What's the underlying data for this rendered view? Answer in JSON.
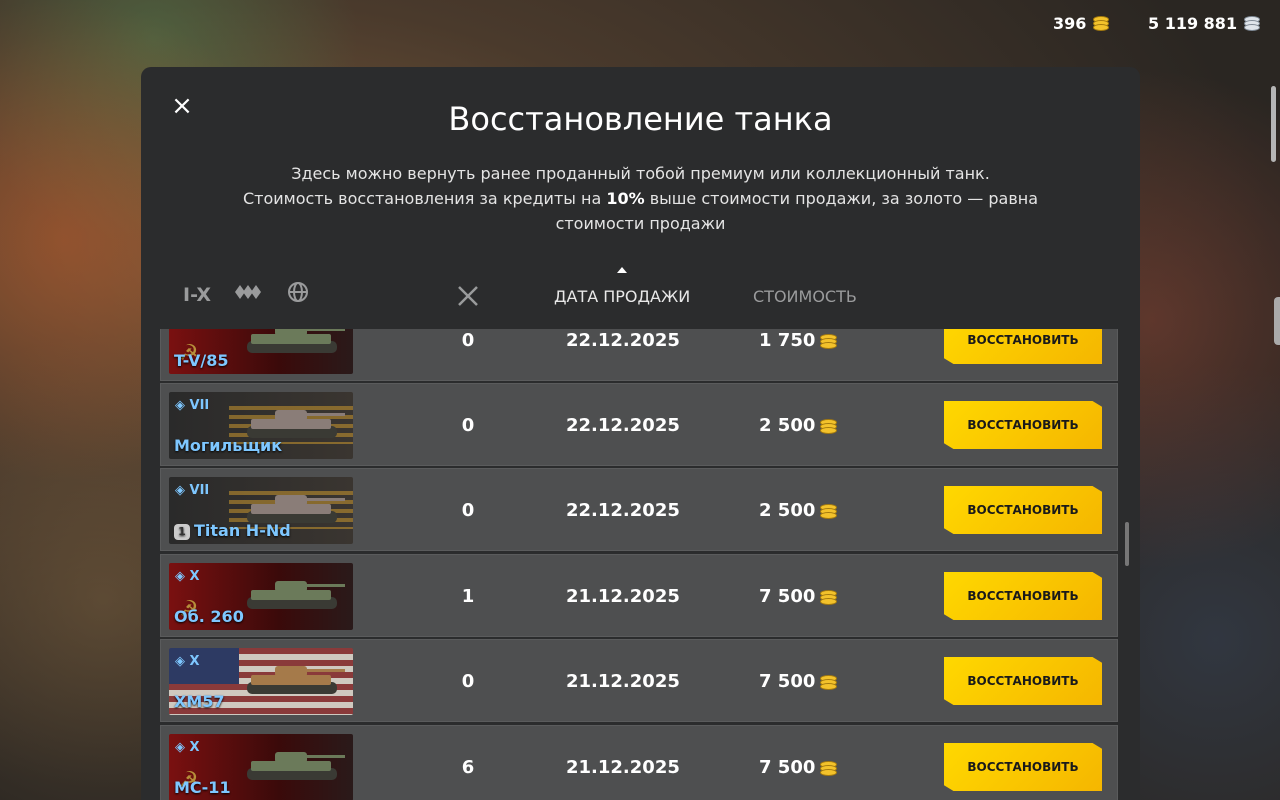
{
  "currency": {
    "gold": "396",
    "credits": "5 119 881"
  },
  "modal": {
    "title": "Восстановление танка",
    "desc_line1": "Здесь можно вернуть ранее проданный тобой премиум или коллекционный танк.",
    "desc_line2_a": "Стоимость восстановления за кредиты на ",
    "desc_line2_b": "10%",
    "desc_line2_c": " выше стоимости продажи, за золото — равна стоимости продажи"
  },
  "filters": {
    "tier": "I-X",
    "type_icon": "vehicle-type-icon",
    "nation_icon": "globe-icon"
  },
  "columns": {
    "battles_icon": "crossed-swords-icon",
    "date": "ДАТА ПРОДАЖИ",
    "cost": "СТОИМОСТЬ"
  },
  "rows": [
    {
      "tier": "",
      "name": "T-V/85",
      "flag": "ussr",
      "battles": "0",
      "date": "22.12.2025",
      "price": "1 750",
      "button": "ВОССТАНОВИТЬ"
    },
    {
      "tier": "VII",
      "name": "Могильщик",
      "flag": "dark",
      "battles": "0",
      "date": "22.12.2025",
      "price": "2 500",
      "button": "ВОССТАНОВИТЬ"
    },
    {
      "tier": "VII",
      "name": "Titan H-Nd",
      "flag": "dark",
      "mastery": "1",
      "battles": "0",
      "date": "22.12.2025",
      "price": "2 500",
      "button": "ВОССТАНОВИТЬ"
    },
    {
      "tier": "X",
      "name": "Об. 260",
      "flag": "ussr",
      "battles": "1",
      "date": "21.12.2025",
      "price": "7 500",
      "button": "ВОССТАНОВИТЬ"
    },
    {
      "tier": "X",
      "name": "XM57",
      "flag": "usa",
      "battles": "0",
      "date": "21.12.2025",
      "price": "7 500",
      "button": "ВОССТАНОВИТЬ"
    },
    {
      "tier": "X",
      "name": "МС-11",
      "flag": "ussr",
      "battles": "6",
      "date": "21.12.2025",
      "price": "7 500",
      "button": "ВОССТАНОВИТЬ"
    }
  ]
}
